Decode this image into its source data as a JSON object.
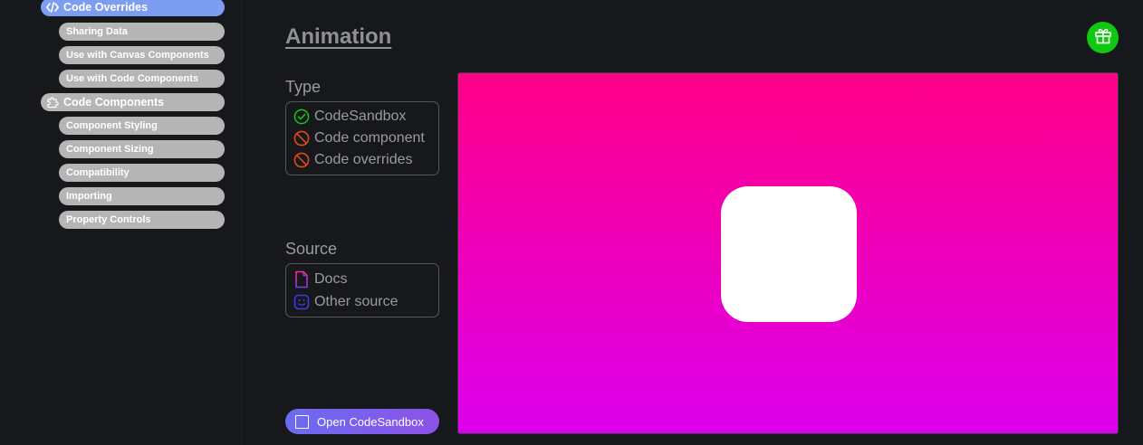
{
  "sidebar": {
    "main_items": [
      {
        "label": "Code Overrides",
        "icon": "code-icon",
        "active": true
      },
      {
        "label": "Code Components",
        "icon": "puzzle-icon",
        "active": false
      }
    ],
    "overrides_subitems": [
      {
        "label": "Sharing Data"
      },
      {
        "label": "Use with Canvas Components"
      },
      {
        "label": "Use with Code Components"
      }
    ],
    "components_subitems": [
      {
        "label": "Component Styling"
      },
      {
        "label": "Component Sizing"
      },
      {
        "label": "Compatibility"
      },
      {
        "label": "Importing"
      },
      {
        "label": "Property Controls"
      }
    ],
    "colors": {
      "active": "#7d9ef0",
      "inactive": "#b5b5b5"
    }
  },
  "main": {
    "title": "Animation",
    "type_label": "Type",
    "type_items": [
      {
        "label": "CodeSandbox",
        "status": "check",
        "icon": "check-circle-icon",
        "color": "#17c417"
      },
      {
        "label": "Code component",
        "status": "blocked",
        "icon": "block-icon",
        "color": "#e24a1a"
      },
      {
        "label": "Code overrides",
        "status": "blocked",
        "icon": "block-icon",
        "color": "#e24a1a"
      }
    ],
    "source_label": "Source",
    "source_items": [
      {
        "label": "Docs",
        "icon": "document-icon"
      },
      {
        "label": "Other source",
        "icon": "smiley-icon"
      }
    ],
    "open_button_label": "Open CodeSandbox",
    "gift_icon": "gift-icon",
    "preview": {
      "gradient_top": "#ff0088",
      "gradient_bottom": "#dd00ee",
      "shape_color": "#ffffff"
    }
  }
}
